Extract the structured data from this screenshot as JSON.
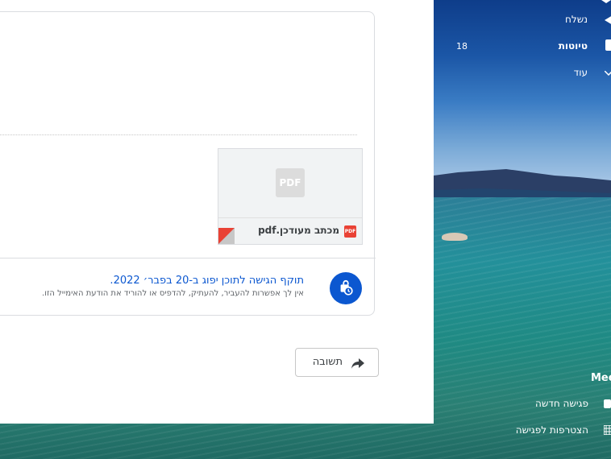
{
  "sidebar": {
    "items": [
      {
        "label": "נשלח"
      },
      {
        "label": "טיוטות",
        "count": "18"
      },
      {
        "label": "עוד"
      }
    ],
    "meet": {
      "title": "Mee",
      "items": [
        {
          "label": "פגישה חדשה"
        },
        {
          "label": "הצטרפות לפגישה"
        }
      ]
    }
  },
  "attachment": {
    "filename": "מכתב מעודכן.pdf",
    "thumb_label": "PDF",
    "type_label": "PDF"
  },
  "notice": {
    "title": "תוקף הגישה לתוכן יפוג ב-20 בפבר׳ 2022.",
    "subtitle": "אין לך אפשרות להעביר, להעתיק, להדפיס או להוריד את הודעת האימייל הזו."
  },
  "actions": {
    "reply_label": "תשובה"
  },
  "colors": {
    "accent": "#0b57d0",
    "pdf_red": "#e94235"
  }
}
